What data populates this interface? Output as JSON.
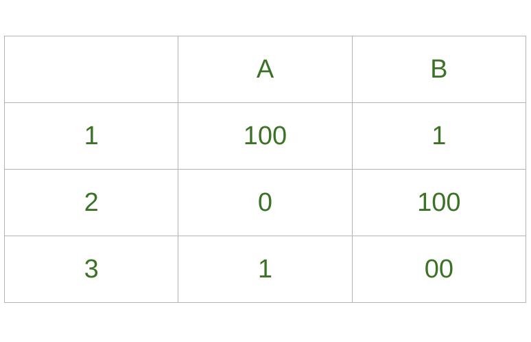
{
  "table": {
    "headers": [
      "",
      "A",
      "B"
    ],
    "rows": [
      [
        "1",
        "100",
        "1"
      ],
      [
        "2",
        "0",
        "100"
      ],
      [
        "3",
        "1",
        "00"
      ]
    ]
  },
  "colors": {
    "text": "#3a7323",
    "border": "#b3b3b3"
  }
}
